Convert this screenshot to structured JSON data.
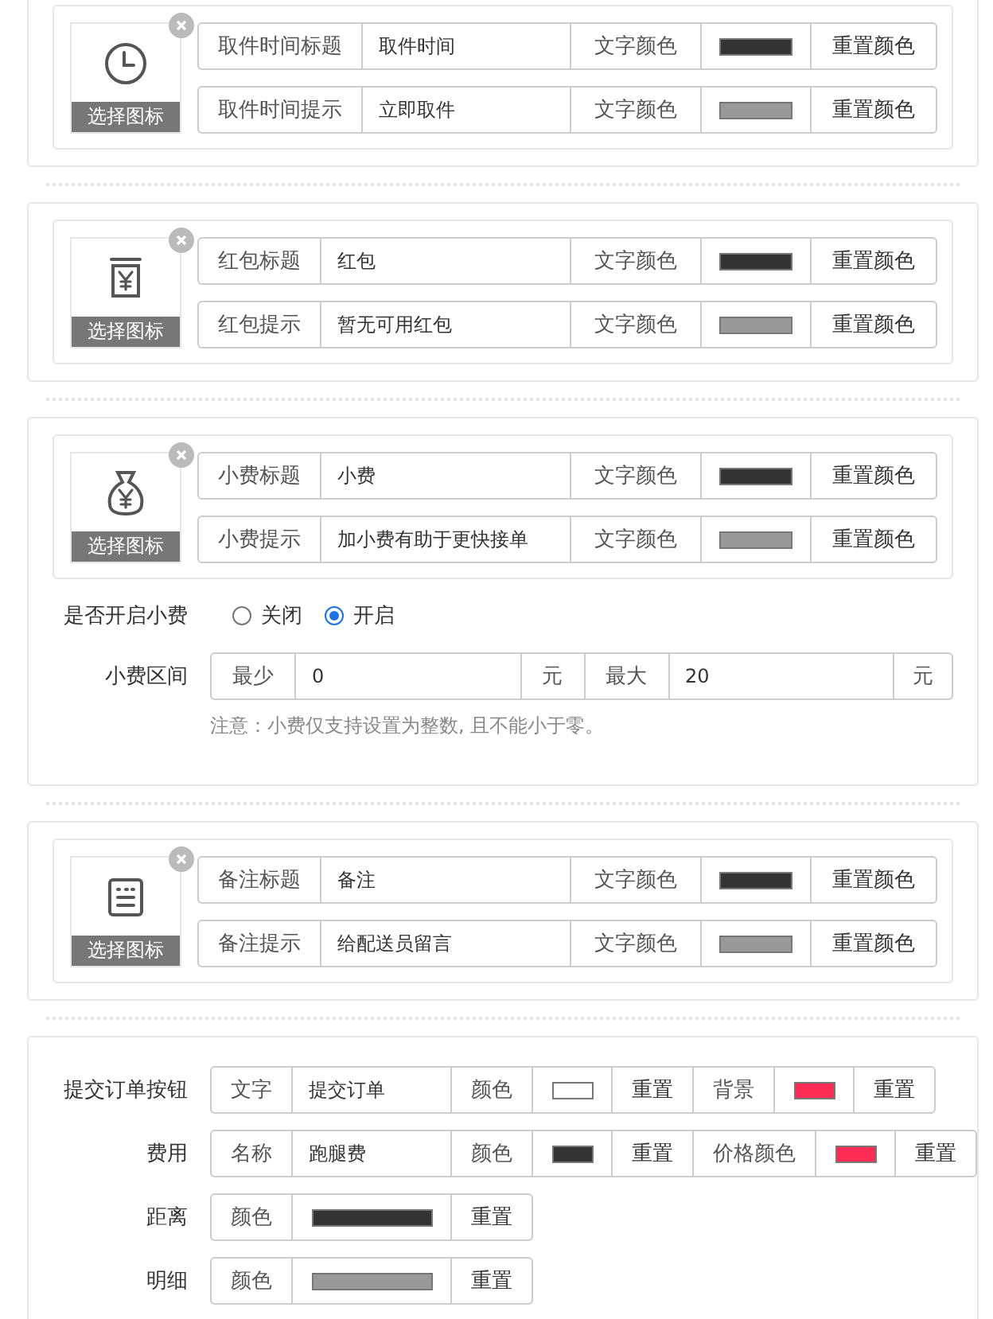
{
  "icon_cards": [
    {
      "kind": "clock",
      "choose_label": "选择图标",
      "rows": [
        {
          "label": "取件时间标题",
          "value": "取件时间",
          "color_label": "文字颜色",
          "color": "#333333",
          "reset": "重置颜色"
        },
        {
          "label": "取件时间提示",
          "value": "立即取件",
          "color_label": "文字颜色",
          "color": "#999999",
          "reset": "重置颜色"
        }
      ]
    },
    {
      "kind": "jar",
      "choose_label": "选择图标",
      "rows": [
        {
          "label": "红包标题",
          "value": "红包",
          "color_label": "文字颜色",
          "color": "#333333",
          "reset": "重置颜色"
        },
        {
          "label": "红包提示",
          "value": "暂无可用红包",
          "color_label": "文字颜色",
          "color": "#999999",
          "reset": "重置颜色"
        }
      ]
    },
    {
      "kind": "bag",
      "choose_label": "选择图标",
      "rows": [
        {
          "label": "小费标题",
          "value": "小费",
          "color_label": "文字颜色",
          "color": "#333333",
          "reset": "重置颜色"
        },
        {
          "label": "小费提示",
          "value": "加小费有助于更快接单",
          "color_label": "文字颜色",
          "color": "#999999",
          "reset": "重置颜色"
        }
      ],
      "tip": {
        "toggle_label": "是否开启小费",
        "options": [
          {
            "label": "关闭",
            "selected": false
          },
          {
            "label": "开启",
            "selected": true
          }
        ],
        "range_label": "小费区间",
        "min_label": "最少",
        "min_value": "0",
        "min_unit": "元",
        "max_label": "最大",
        "max_value": "20",
        "max_unit": "元",
        "note": "注意：小费仅支持设置为整数, 且不能小于零。"
      }
    },
    {
      "kind": "note",
      "choose_label": "选择图标",
      "rows": [
        {
          "label": "备注标题",
          "value": "备注",
          "color_label": "文字颜色",
          "color": "#333333",
          "reset": "重置颜色"
        },
        {
          "label": "备注提示",
          "value": "给配送员留言",
          "color_label": "文字颜色",
          "color": "#999999",
          "reset": "重置颜色"
        }
      ]
    }
  ],
  "bottom_rows": [
    {
      "label": "提交订单按钮",
      "parts": [
        {
          "kind": "addon",
          "text": "文字"
        },
        {
          "kind": "input",
          "value": "提交订单"
        },
        {
          "kind": "addon",
          "text": "颜色"
        },
        {
          "kind": "swatch",
          "color": "#ffffff"
        },
        {
          "kind": "button",
          "text": "重置"
        },
        {
          "kind": "addon",
          "text": "背景"
        },
        {
          "kind": "swatch",
          "color": "#ff2d55"
        },
        {
          "kind": "button",
          "text": "重置"
        }
      ]
    },
    {
      "label": "费用",
      "parts": [
        {
          "kind": "addon",
          "text": "名称"
        },
        {
          "kind": "input",
          "value": "跑腿费"
        },
        {
          "kind": "addon",
          "text": "颜色"
        },
        {
          "kind": "swatch",
          "color": "#333333"
        },
        {
          "kind": "button",
          "text": "重置"
        },
        {
          "kind": "addon",
          "text": "价格颜色"
        },
        {
          "kind": "swatch",
          "color": "#ff2d55"
        },
        {
          "kind": "button",
          "text": "重置"
        }
      ]
    },
    {
      "label": "距离",
      "parts": [
        {
          "kind": "addon",
          "text": "颜色"
        },
        {
          "kind": "bar",
          "color": "#333333"
        },
        {
          "kind": "button",
          "text": "重置"
        }
      ]
    },
    {
      "label": "明细",
      "parts": [
        {
          "kind": "addon",
          "text": "颜色"
        },
        {
          "kind": "bar",
          "color": "#999999"
        },
        {
          "kind": "button",
          "text": "重置"
        }
      ]
    }
  ]
}
